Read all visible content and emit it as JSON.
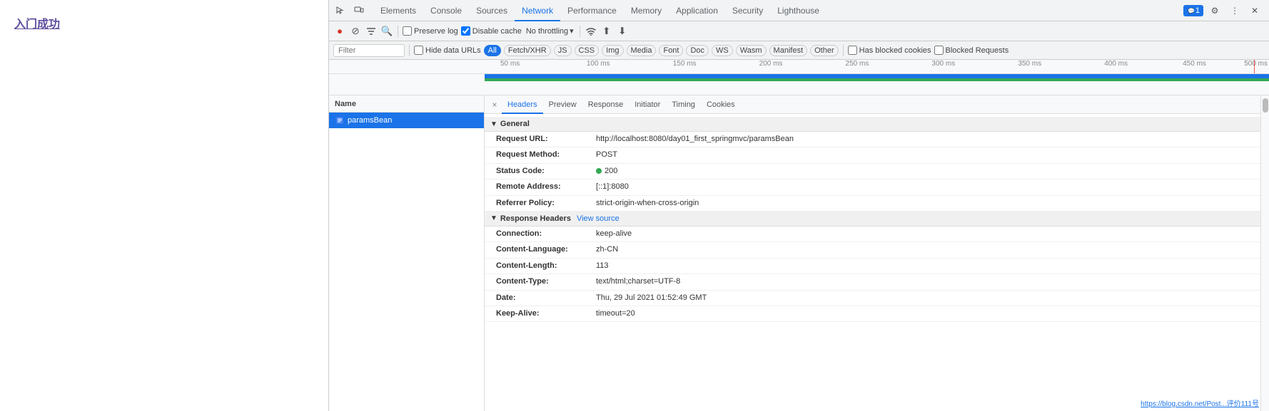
{
  "page": {
    "title": "入门成功"
  },
  "devtools": {
    "tabs": [
      {
        "id": "elements",
        "label": "Elements",
        "active": false
      },
      {
        "id": "console",
        "label": "Console",
        "active": false
      },
      {
        "id": "sources",
        "label": "Sources",
        "active": false
      },
      {
        "id": "network",
        "label": "Network",
        "active": true
      },
      {
        "id": "performance",
        "label": "Performance",
        "active": false
      },
      {
        "id": "memory",
        "label": "Memory",
        "active": false
      },
      {
        "id": "application",
        "label": "Application",
        "active": false
      },
      {
        "id": "security",
        "label": "Security",
        "active": false
      },
      {
        "id": "lighthouse",
        "label": "Lighthouse",
        "active": false
      }
    ],
    "badge": "1"
  },
  "network": {
    "toolbar": {
      "preserve_log_label": "Preserve log",
      "disable_cache_label": "Disable cache",
      "throttle_label": "No throttling",
      "disable_cache_checked": true,
      "preserve_log_checked": false
    },
    "filter": {
      "placeholder": "Filter",
      "hide_data_urls_label": "Hide data URLs",
      "filters": [
        "All",
        "Fetch/XHR",
        "JS",
        "CSS",
        "Img",
        "Media",
        "Font",
        "Doc",
        "WS",
        "Wasm",
        "Manifest",
        "Other"
      ],
      "active_filter": "All",
      "has_blocked_cookies_label": "Has blocked cookies",
      "blocked_requests_label": "Blocked Requests"
    },
    "timeline": {
      "markers": [
        "50 ms",
        "100 ms",
        "150 ms",
        "200 ms",
        "250 ms",
        "300 ms",
        "350 ms",
        "400 ms",
        "450 ms",
        "500 ms"
      ]
    },
    "files": [
      {
        "name": "paramsBean",
        "selected": true
      }
    ],
    "file_list_header": "Name",
    "detail": {
      "close_label": "×",
      "tabs": [
        {
          "id": "headers",
          "label": "Headers",
          "active": true
        },
        {
          "id": "preview",
          "label": "Preview",
          "active": false
        },
        {
          "id": "response",
          "label": "Response",
          "active": false
        },
        {
          "id": "initiator",
          "label": "Initiator",
          "active": false
        },
        {
          "id": "timing",
          "label": "Timing",
          "active": false
        },
        {
          "id": "cookies",
          "label": "Cookies",
          "active": false
        }
      ],
      "general": {
        "header": "General",
        "rows": [
          {
            "key": "Request URL:",
            "value": "http://localhost:8080/day01_first_springmvc/paramsBean"
          },
          {
            "key": "Request Method:",
            "value": "POST"
          },
          {
            "key": "Status Code:",
            "value": "200",
            "has_dot": true
          },
          {
            "key": "Remote Address:",
            "value": "[::1]:8080"
          },
          {
            "key": "Referrer Policy:",
            "value": "strict-origin-when-cross-origin"
          }
        ]
      },
      "response_headers": {
        "header": "Response Headers",
        "view_source": "View source",
        "rows": [
          {
            "key": "Connection:",
            "value": "keep-alive"
          },
          {
            "key": "Content-Language:",
            "value": "zh-CN"
          },
          {
            "key": "Content-Length:",
            "value": "113"
          },
          {
            "key": "Content-Type:",
            "value": "text/html;charset=UTF-8"
          },
          {
            "key": "Date:",
            "value": "Thu, 29 Jul 2021 01:52:49 GMT"
          },
          {
            "key": "Keep-Alive:",
            "value": "timeout=20"
          }
        ]
      }
    }
  },
  "url_hint": "https://blog.csdn.net/Post...评价111号"
}
